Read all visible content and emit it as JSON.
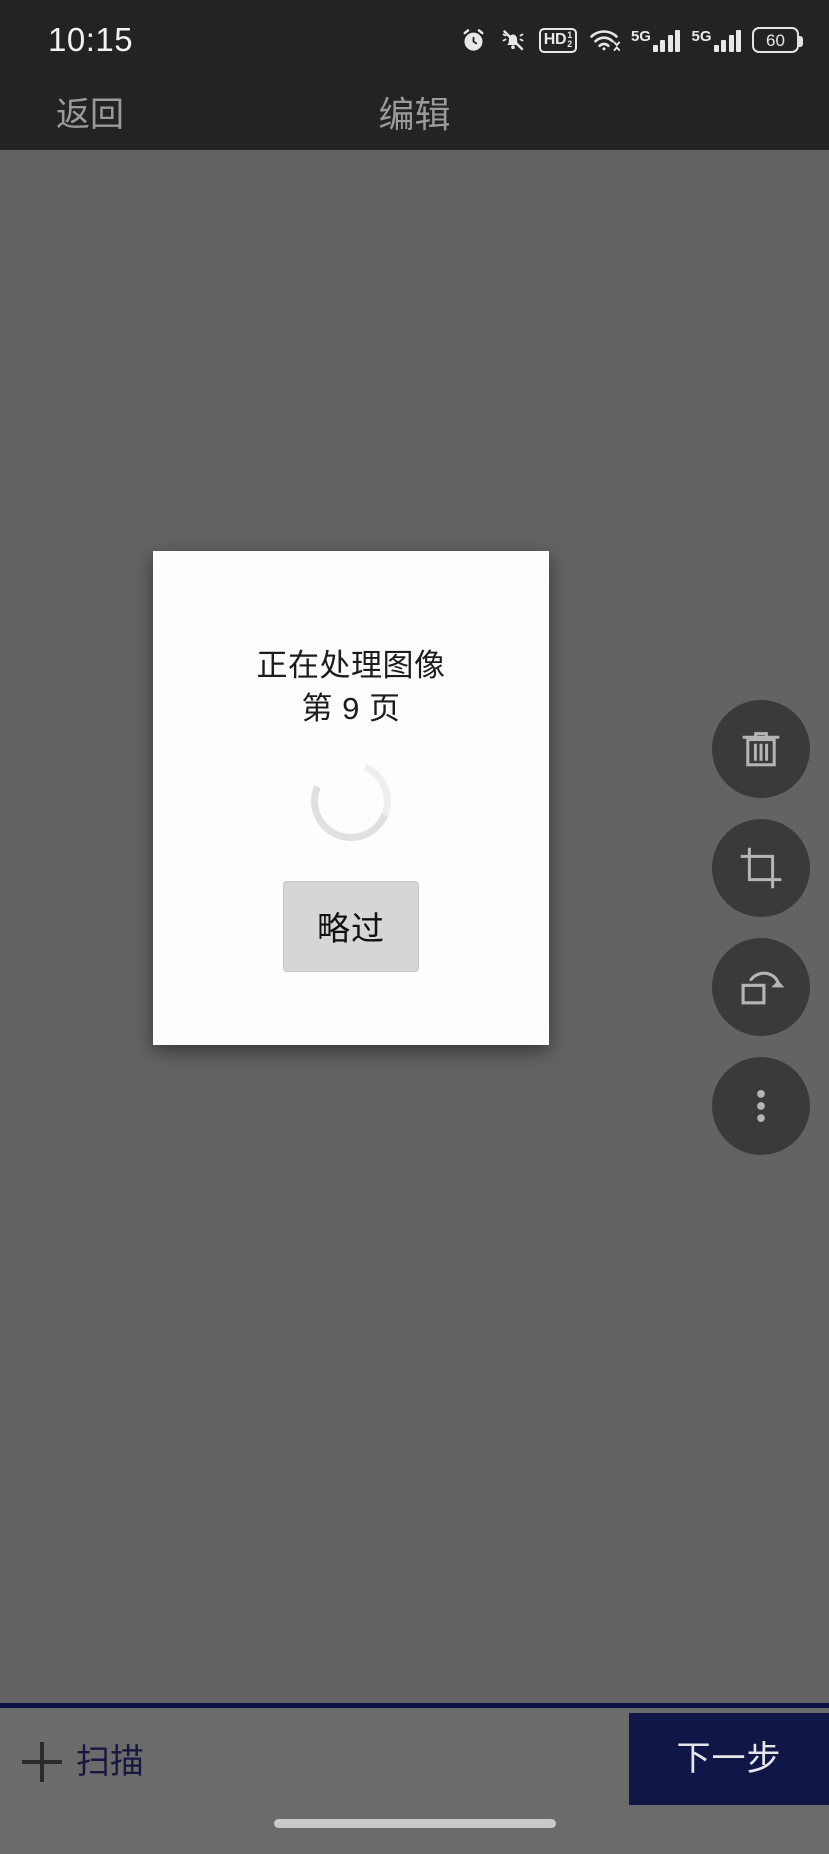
{
  "status_bar": {
    "time": "10:15",
    "battery_level": "60",
    "icons": [
      "alarm-clock-icon",
      "bell-muted-icon",
      "hd-voice-icon",
      "wifi-icon",
      "signal-5g-sim1-icon",
      "signal-5g-sim2-icon",
      "battery-icon"
    ],
    "hd_label": "HD",
    "hd_sup": "1",
    "hd_sub": "2",
    "network_label_sim1": "5G",
    "network_label_sim2": "5G"
  },
  "app_bar": {
    "back_label": "返回",
    "title": "编辑"
  },
  "side_tools": [
    {
      "name": "delete-button",
      "icon": "trash-icon"
    },
    {
      "name": "crop-button",
      "icon": "crop-icon"
    },
    {
      "name": "rotate-button",
      "icon": "rotate-icon"
    },
    {
      "name": "more-button",
      "icon": "more-vertical-icon"
    }
  ],
  "dialog": {
    "title": "正在处理图像",
    "page_text": "第 9 页",
    "page_number": 9,
    "skip_label": "略过",
    "spinner": "loading-spinner"
  },
  "bottom_bar": {
    "scan_label": "扫描",
    "scan_icon": "plus-icon",
    "next_label": "下一步",
    "home_indicator": "home-indicator"
  },
  "colors": {
    "status_bar_bg": "#232323",
    "app_bar_bg": "#232323",
    "overlay_dim": "#636363",
    "dialog_bg": "#fdfdfd",
    "fab_bg": "#3a3a3a",
    "accent_navy": "#101645",
    "divider_navy": "#0d1340",
    "bottom_bar_bg": "#6b6b6b",
    "skip_button_bg": "#d6d6d6"
  }
}
